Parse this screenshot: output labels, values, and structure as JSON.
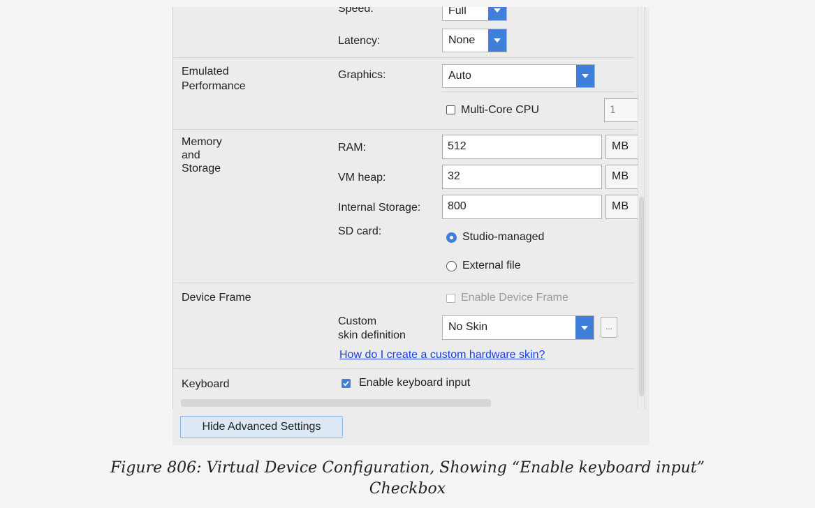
{
  "network": {
    "speed_label": "Speed:",
    "speed_value": "Full",
    "latency_label": "Latency:",
    "latency_value": "None"
  },
  "emulated_performance": {
    "section_label_line1": "Emulated",
    "section_label_line2": "Performance",
    "graphics_label": "Graphics:",
    "graphics_value": "Auto",
    "multicore_label": "Multi-Core CPU",
    "multicore_checked": false,
    "multicore_count": "1"
  },
  "memory_storage": {
    "section_label_line1": "Memory",
    "section_label_line2": "and",
    "section_label_line3": "Storage",
    "ram_label": "RAM:",
    "ram_value": "512",
    "ram_unit": "MB",
    "vmheap_label": "VM heap:",
    "vmheap_value": "32",
    "vmheap_unit": "MB",
    "internal_label": "Internal Storage:",
    "internal_value": "800",
    "internal_unit": "MB",
    "sdcard_label": "SD card:",
    "sdcard_options": [
      "Studio-managed",
      "External file"
    ],
    "sdcard_selected": "Studio-managed"
  },
  "device_frame": {
    "section_label": "Device Frame",
    "enable_frame_label": "Enable Device Frame",
    "enable_frame_checked": false,
    "custom_skin_label_line1": "Custom",
    "custom_skin_label_line2": "skin definition",
    "skin_value": "No Skin",
    "browse_label": "...",
    "help_link": "How do I create a custom hardware skin?"
  },
  "keyboard": {
    "section_label": "Keyboard",
    "enable_input_label": "Enable keyboard input",
    "enable_input_checked": true
  },
  "footer": {
    "hide_advanced_button": "Hide Advanced Settings"
  },
  "caption": {
    "line1": "Figure 806: Virtual Device Configuration, Showing “Enable keyboard input”",
    "line2": "Checkbox"
  },
  "colors": {
    "accent": "#3f7fd9",
    "link": "#1a3fe0",
    "panel_bg": "#ececec"
  }
}
